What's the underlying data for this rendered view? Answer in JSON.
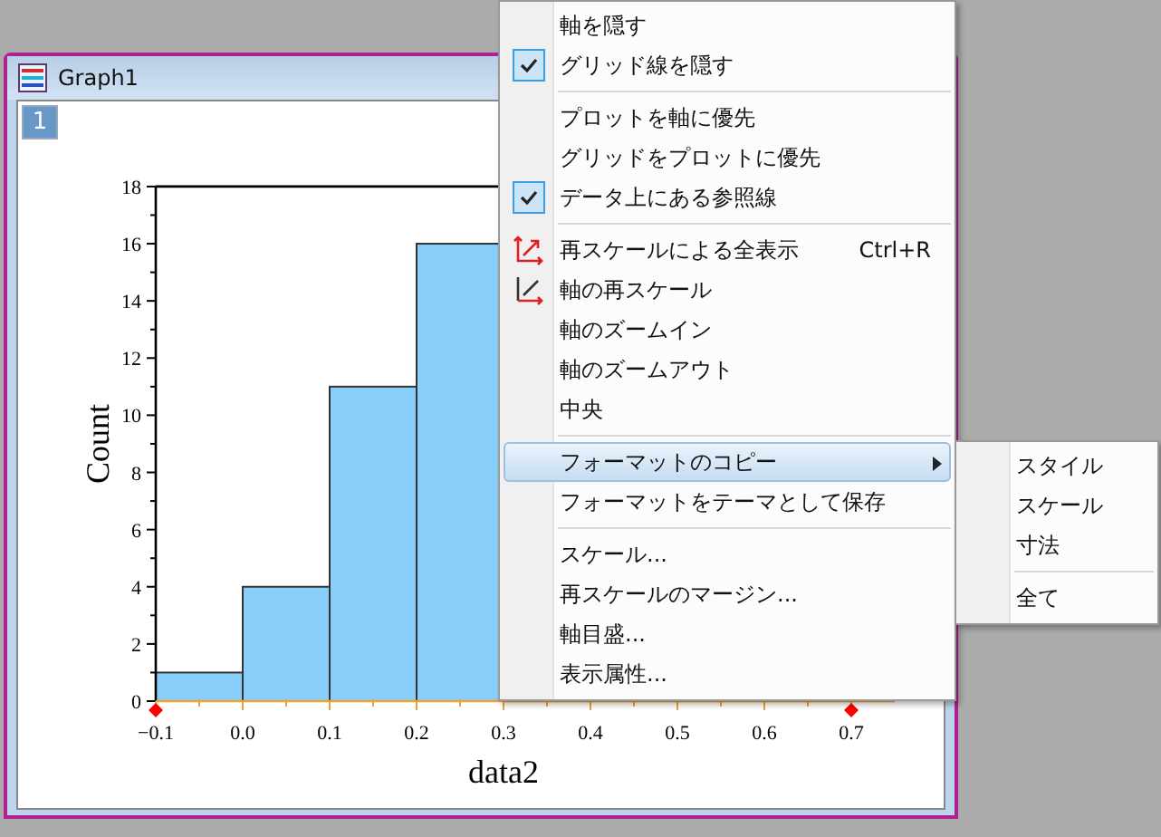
{
  "window": {
    "title": "Graph1",
    "layer": "1"
  },
  "chart_data": {
    "type": "bar",
    "xlabel": "data2",
    "ylabel": "Count",
    "x": [
      -0.05,
      0.05,
      0.15,
      0.25
    ],
    "values": [
      1,
      4,
      11,
      16
    ],
    "xlim": [
      -0.1,
      0.75
    ],
    "ylim": [
      0,
      18
    ],
    "xticks": [
      {
        "value": -0.1,
        "label": "−0.1"
      },
      {
        "value": 0,
        "label": "0.0"
      },
      {
        "value": 0.1,
        "label": "0.1"
      },
      {
        "value": 0.2,
        "label": "0.2"
      },
      {
        "value": 0.3,
        "label": "0.3"
      },
      {
        "value": 0.4,
        "label": "0.4"
      },
      {
        "value": 0.5,
        "label": "0.5"
      },
      {
        "value": 0.6,
        "label": "0.6"
      },
      {
        "value": 0.7,
        "label": "0.7"
      }
    ],
    "yticks": [
      0,
      2,
      4,
      6,
      8,
      10,
      12,
      14,
      16,
      18
    ]
  },
  "context_menu": {
    "items": [
      {
        "kind": "item",
        "label": "軸を隠す",
        "checked": false
      },
      {
        "kind": "item",
        "label": "グリッド線を隠す",
        "checked": true
      },
      {
        "kind": "separator"
      },
      {
        "kind": "item",
        "label": "プロットを軸に優先",
        "checked": false
      },
      {
        "kind": "item",
        "label": "グリッドをプロットに優先",
        "checked": false
      },
      {
        "kind": "item",
        "label": "データ上にある参照線",
        "checked": true
      },
      {
        "kind": "separator"
      },
      {
        "kind": "icon",
        "label": "再スケールによる全表示",
        "shortcut": "Ctrl+R"
      },
      {
        "kind": "icon",
        "label": "軸の再スケール"
      },
      {
        "kind": "item",
        "label": "軸のズームイン"
      },
      {
        "kind": "item",
        "label": "軸のズームアウト"
      },
      {
        "kind": "item",
        "label": "中央"
      },
      {
        "kind": "separator"
      },
      {
        "kind": "submenu",
        "label": "フォーマットのコピー",
        "selected": true
      },
      {
        "kind": "item",
        "label": "フォーマットをテーマとして保存"
      },
      {
        "kind": "separator"
      },
      {
        "kind": "item",
        "label": "スケール..."
      },
      {
        "kind": "item",
        "label": "再スケールのマージン..."
      },
      {
        "kind": "item",
        "label": "軸目盛..."
      },
      {
        "kind": "item",
        "label": "表示属性..."
      }
    ]
  },
  "submenu": {
    "items": [
      {
        "kind": "item",
        "label": "スタイル"
      },
      {
        "kind": "item",
        "label": "スケール"
      },
      {
        "kind": "item",
        "label": "寸法"
      },
      {
        "kind": "separator"
      },
      {
        "kind": "item",
        "label": "全て"
      }
    ]
  }
}
